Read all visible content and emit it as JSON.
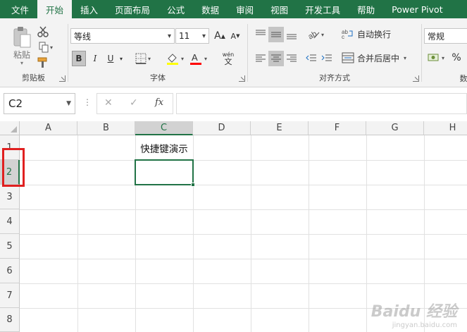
{
  "tabs": [
    "文件",
    "开始",
    "插入",
    "页面布局",
    "公式",
    "数据",
    "审阅",
    "视图",
    "开发工具",
    "帮助",
    "Power Pivot"
  ],
  "active_tab_index": 1,
  "ribbon": {
    "clipboard": {
      "label": "剪贴板",
      "paste_label": "粘贴",
      "icons": [
        "paste-icon",
        "cut-icon",
        "copy-icon",
        "format-painter-icon"
      ]
    },
    "font": {
      "label": "字体",
      "font_name": "等线",
      "font_size": "11",
      "grow_label": "A",
      "shrink_label": "A",
      "bold": "B",
      "italic": "I",
      "underline": "U",
      "font_color_label": "A",
      "phonetic_label": "wén",
      "phonetic_sub": "文",
      "highlight_color": "#ffff00",
      "font_color": "#ff0000"
    },
    "alignment": {
      "label": "对齐方式",
      "wrap_text": "自动换行",
      "merge_center": "合并后居中"
    },
    "number": {
      "format": "常规",
      "percent": "%",
      "label_partial": "数"
    }
  },
  "formula_bar": {
    "name_box": "C2",
    "cancel_symbol": "✕",
    "enter_symbol": "✓",
    "fx_label": "fx",
    "formula_value": ""
  },
  "sheet": {
    "columns": [
      "A",
      "B",
      "C",
      "D",
      "E",
      "F",
      "G",
      "H"
    ],
    "selected_column": "C",
    "rows": [
      "1",
      "2",
      "3",
      "4",
      "5",
      "6",
      "7",
      "8"
    ],
    "selected_row": "2",
    "cells": {
      "C1": "快捷键演示",
      "C2": ""
    }
  },
  "accent_color": "#217346",
  "highlight_box_color": "#e02020",
  "watermark": {
    "text": "Baidu 经验",
    "sub": "jingyan.baidu.com"
  }
}
